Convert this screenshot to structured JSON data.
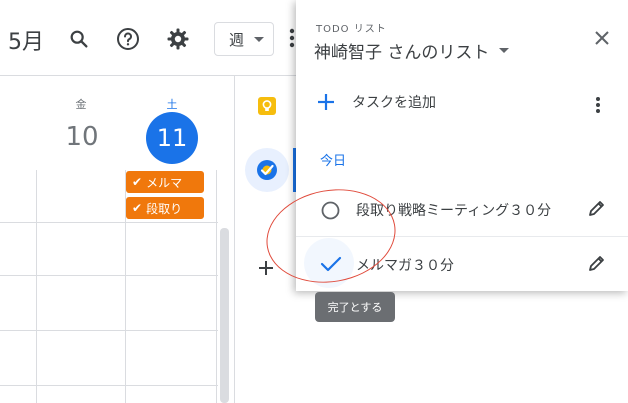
{
  "header": {
    "month": "5月",
    "view": "週"
  },
  "calendar": {
    "days": [
      {
        "name": "金",
        "number": "10",
        "today": false
      },
      {
        "name": "土",
        "number": "11",
        "today": true
      }
    ],
    "events": [
      "メルマ",
      "段取り"
    ]
  },
  "todo_panel": {
    "label": "TODO リスト",
    "list_name": "神崎智子 さんのリスト",
    "add_task_label": "タスクを追加",
    "section_label": "今日",
    "tasks": [
      {
        "title": "段取り戦略ミーティング３０分",
        "completed": false
      },
      {
        "title": "メルマガ３０分",
        "completed": false
      }
    ],
    "tooltip": "完了とする"
  },
  "colors": {
    "accent": "#1a73e8",
    "event": "#f0780c",
    "annotation": "#e04a3b"
  }
}
